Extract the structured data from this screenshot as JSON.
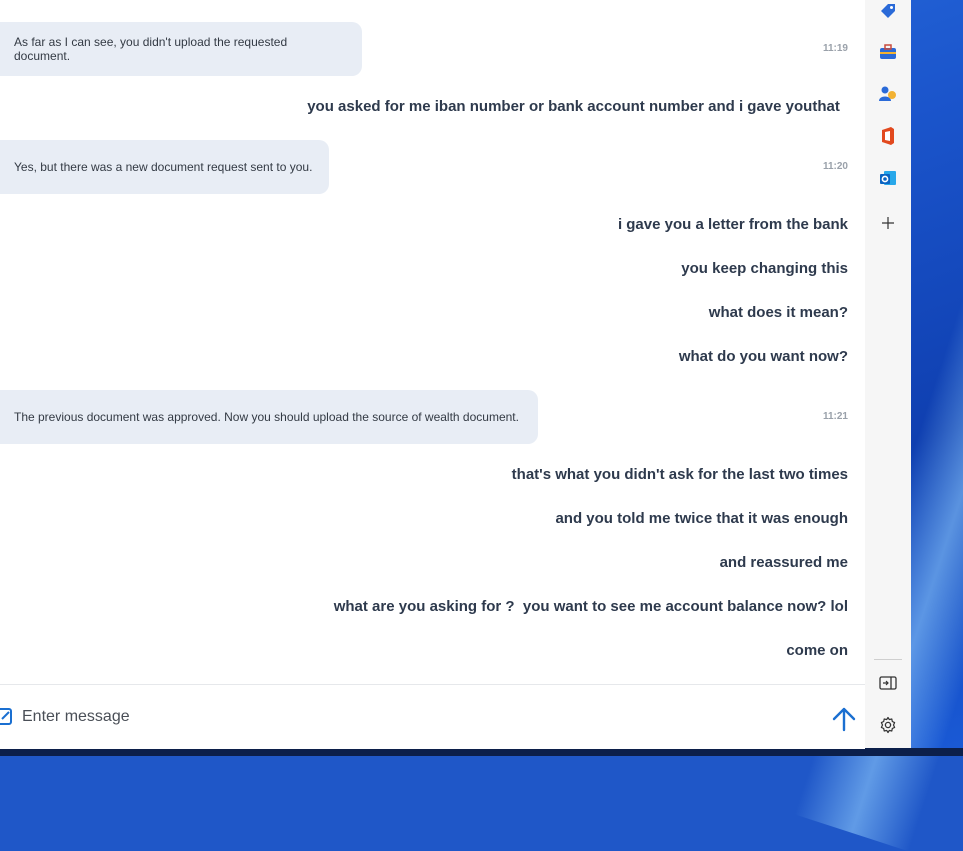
{
  "chat": {
    "messages": [
      {
        "role": "bot",
        "text": "As far as I can see, you didn't upload the requested document.",
        "time": "11:19"
      },
      {
        "role": "user",
        "text": "you asked for me iban number or bank account number and i gave youthat "
      },
      {
        "role": "bot",
        "text": "Yes, but there was a new document request sent to you.",
        "time": "11:20"
      },
      {
        "role": "user",
        "text": "i gave you a letter from the bank"
      },
      {
        "role": "user",
        "text": "you keep changing this"
      },
      {
        "role": "user",
        "text": "what does it mean?"
      },
      {
        "role": "user",
        "text": "what do you want now?"
      },
      {
        "role": "bot",
        "text": "The previous document was approved. Now you should upload the source of wealth document.",
        "time": "11:21"
      },
      {
        "role": "user",
        "text": "that's what you didn't ask for the last two times"
      },
      {
        "role": "user",
        "text": "and you told me twice that it was enough"
      },
      {
        "role": "user",
        "text": "and reassured me"
      },
      {
        "role": "user",
        "text": "what are you asking for ?  you want to see me account balance now? lol"
      },
      {
        "role": "user",
        "text": "come on"
      }
    ]
  },
  "input": {
    "placeholder": "Enter message",
    "value": ""
  },
  "send_icon": "arrow-up-icon",
  "sidebar": {
    "icons": [
      "tag-icon",
      "toolbox-icon",
      "people-icon",
      "office-icon",
      "outlook-icon",
      "add-icon",
      "sidebar-toggle-icon",
      "settings-icon"
    ]
  },
  "colors": {
    "accent": "#1a6fd1",
    "bot_bubble": "#e8edf5",
    "user_text": "#2e3a4d",
    "desktop": "#1f57c8"
  }
}
